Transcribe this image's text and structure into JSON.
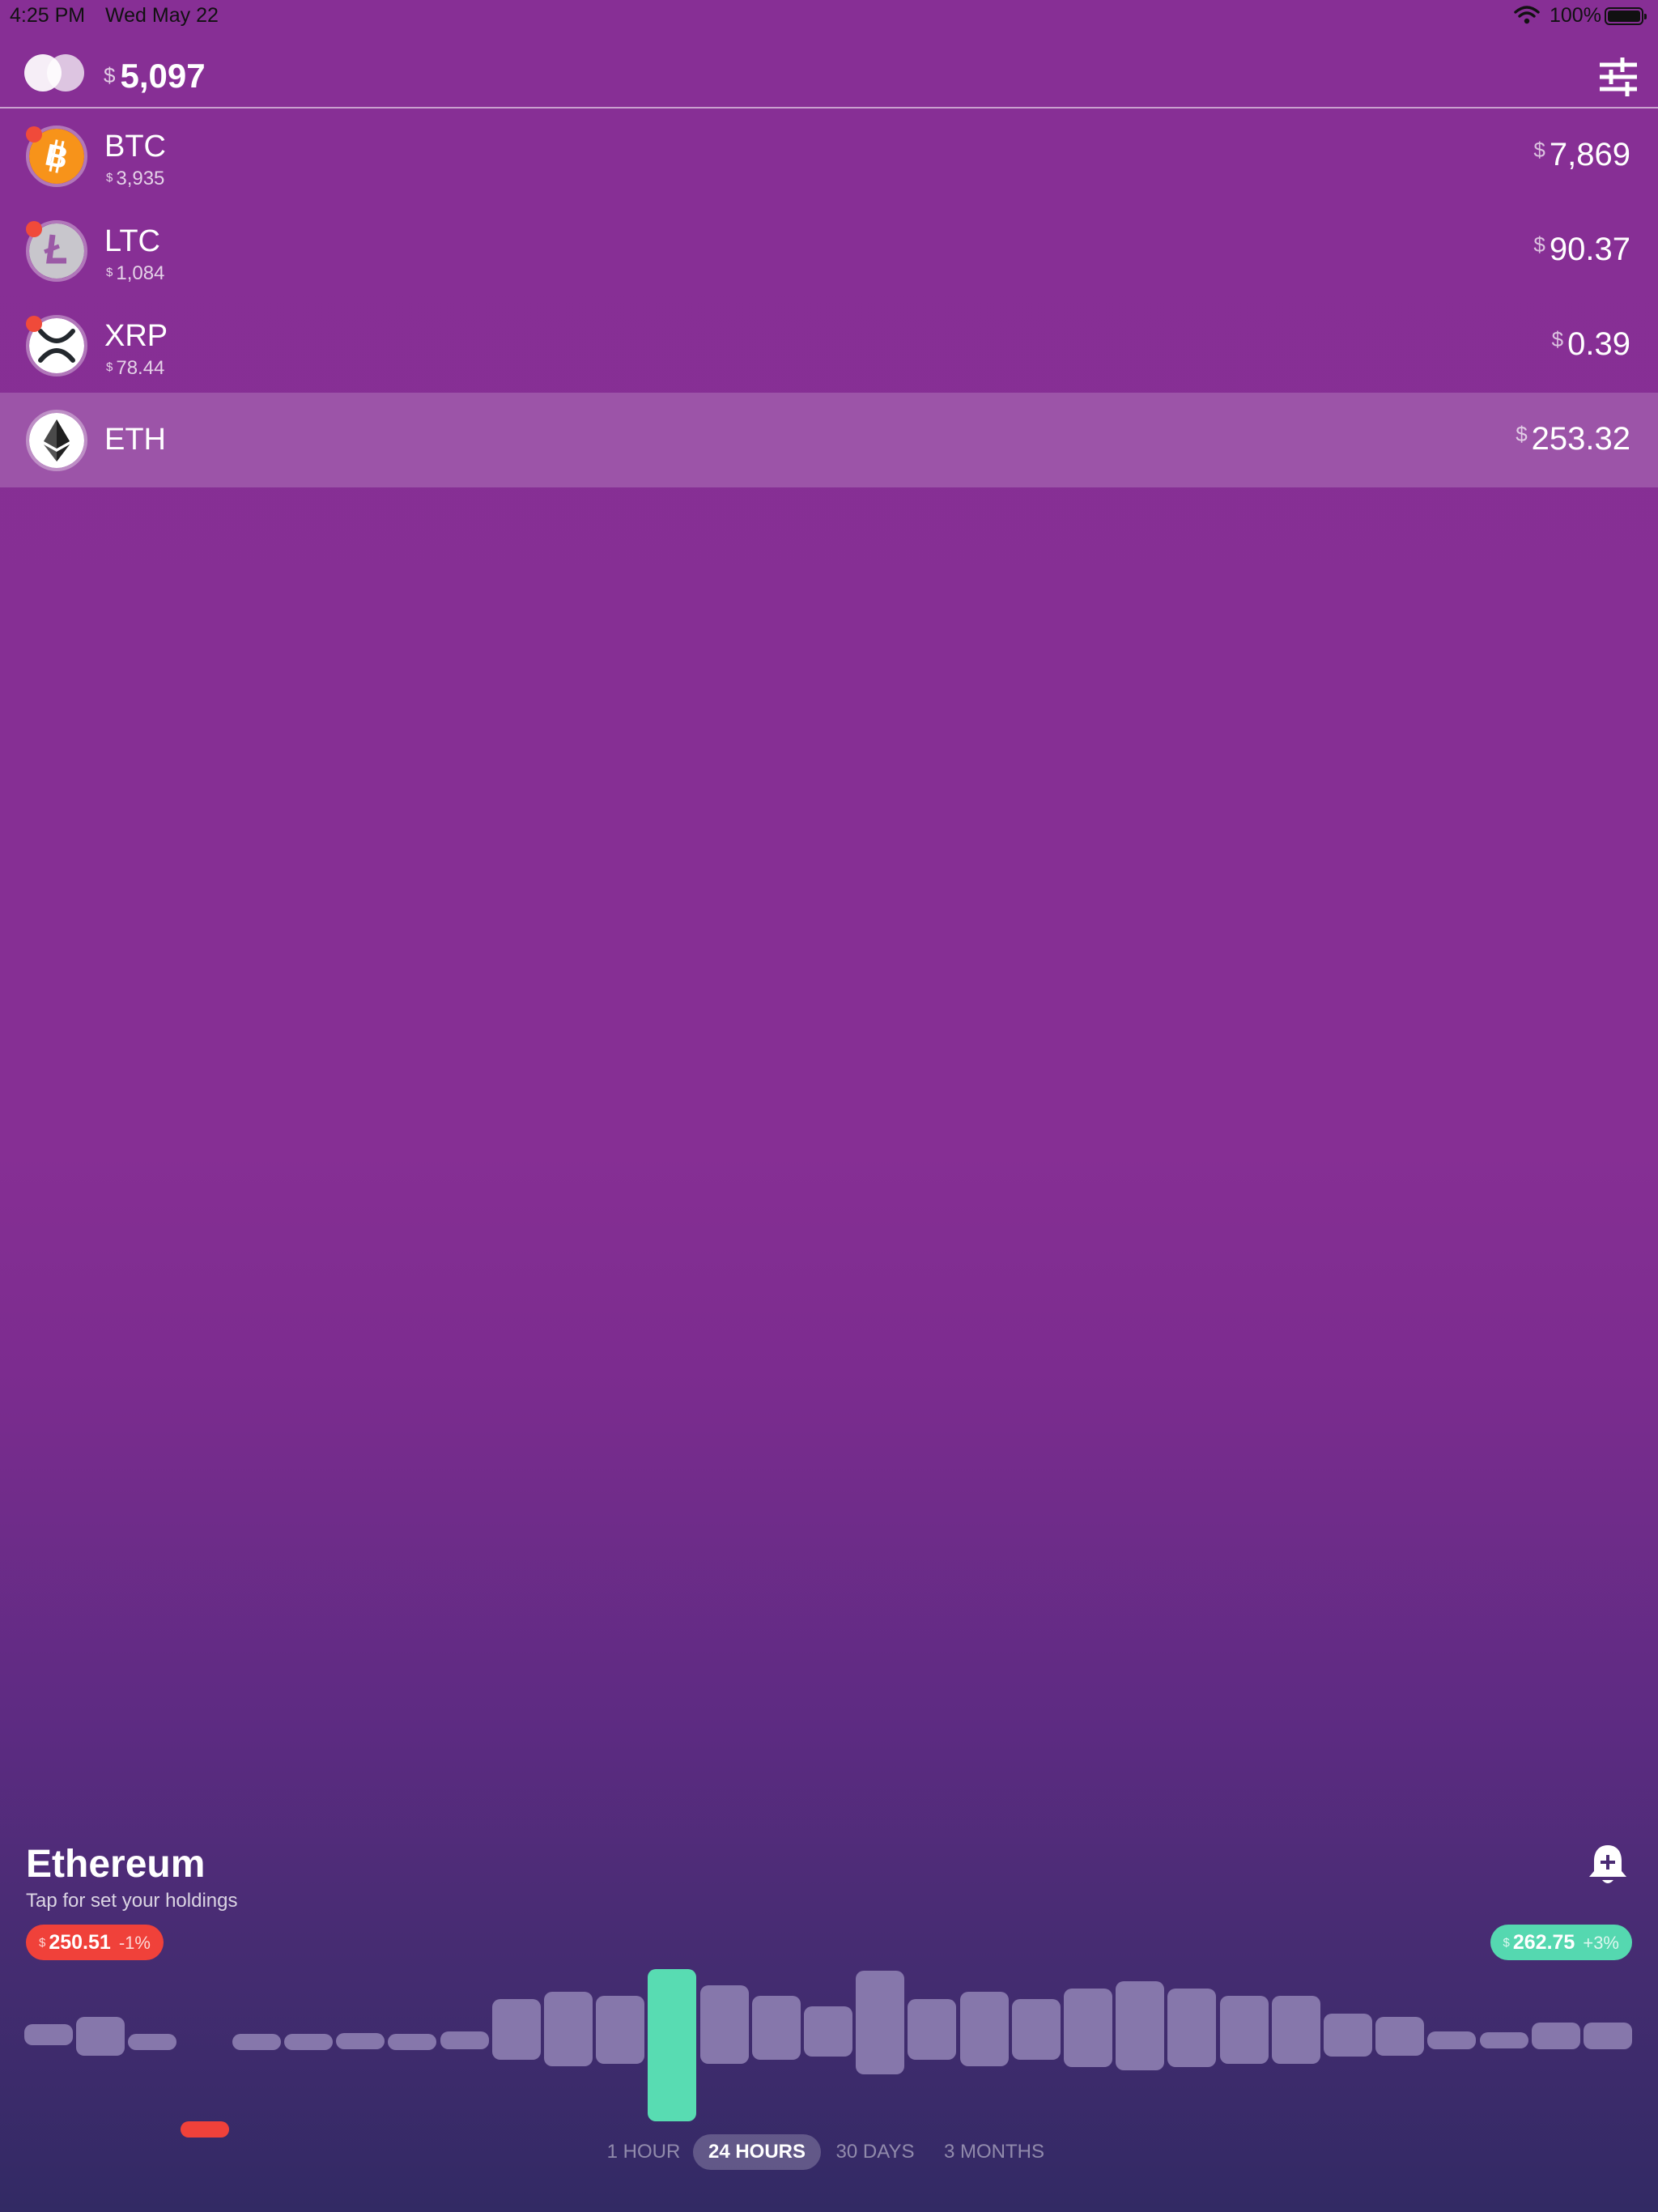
{
  "status_bar": {
    "time": "4:25 PM",
    "date": "Wed May 22",
    "battery": "100%"
  },
  "header": {
    "currency": "$",
    "total": "5,097",
    "filter_icon": "sliders-icon"
  },
  "coins": [
    {
      "symbol": "BTC",
      "holding": "3,935",
      "price": "7,869",
      "alert": true,
      "icon": "bitcoin-icon",
      "color": "#f7931a"
    },
    {
      "symbol": "LTC",
      "holding": "1,084",
      "price": "90.37",
      "alert": true,
      "icon": "litecoin-icon",
      "color": "#bebebe"
    },
    {
      "symbol": "XRP",
      "holding": "78.44",
      "price": "0.39",
      "alert": true,
      "icon": "xrp-icon",
      "color": "#ffffff"
    },
    {
      "symbol": "ETH",
      "holding": "",
      "price": "253.32",
      "alert": false,
      "icon": "ethereum-icon",
      "color": "#ffffff",
      "selected": true
    }
  ],
  "detail": {
    "name": "Ethereum",
    "subtitle": "Tap for set your holdings",
    "low": {
      "currency": "$",
      "value": "250.51",
      "change": "-1%",
      "color": "#f0413a"
    },
    "high": {
      "currency": "$",
      "value": "262.75",
      "change": "+3%",
      "color": "#55d8b0"
    },
    "bell_icon": "bell-plus-icon"
  },
  "chart_data": {
    "type": "bar",
    "bars": [
      {
        "low": 253.6,
        "high": 254.2
      },
      {
        "low": 253.3,
        "high": 254.4
      },
      {
        "low": 253.55,
        "high": 253.85
      },
      {
        "low": 250.51,
        "high": 250.81,
        "marker": "low"
      },
      {
        "low": 253.55,
        "high": 253.85
      },
      {
        "low": 253.55,
        "high": 253.85
      },
      {
        "low": 253.5,
        "high": 253.95
      },
      {
        "low": 253.55,
        "high": 253.85
      },
      {
        "low": 253.5,
        "high": 254.0
      },
      {
        "low": 253.2,
        "high": 254.9
      },
      {
        "low": 253.0,
        "high": 255.1
      },
      {
        "low": 253.1,
        "high": 255.0
      },
      {
        "low": 252.95,
        "high": 262.75,
        "marker": "high"
      },
      {
        "low": 253.1,
        "high": 255.3
      },
      {
        "low": 253.2,
        "high": 255.0
      },
      {
        "low": 253.3,
        "high": 254.7
      },
      {
        "low": 252.8,
        "high": 255.7
      },
      {
        "low": 253.2,
        "high": 254.9
      },
      {
        "low": 253.0,
        "high": 255.1
      },
      {
        "low": 253.2,
        "high": 254.9
      },
      {
        "low": 253.0,
        "high": 255.2
      },
      {
        "low": 252.9,
        "high": 255.4
      },
      {
        "low": 253.0,
        "high": 255.2
      },
      {
        "low": 253.1,
        "high": 255.0
      },
      {
        "low": 253.1,
        "high": 255.0
      },
      {
        "low": 253.3,
        "high": 254.5
      },
      {
        "low": 253.3,
        "high": 254.4
      },
      {
        "low": 253.5,
        "high": 254.0
      },
      {
        "low": 253.55,
        "high": 253.95
      },
      {
        "low": 253.5,
        "high": 254.25
      },
      {
        "low": 253.5,
        "high": 254.25
      }
    ]
  },
  "time_ranges": [
    {
      "label": "1 HOUR",
      "active": false
    },
    {
      "label": "24 HOURS",
      "active": true
    },
    {
      "label": "30 DAYS",
      "active": false
    },
    {
      "label": "3 MONTHS",
      "active": false
    }
  ]
}
